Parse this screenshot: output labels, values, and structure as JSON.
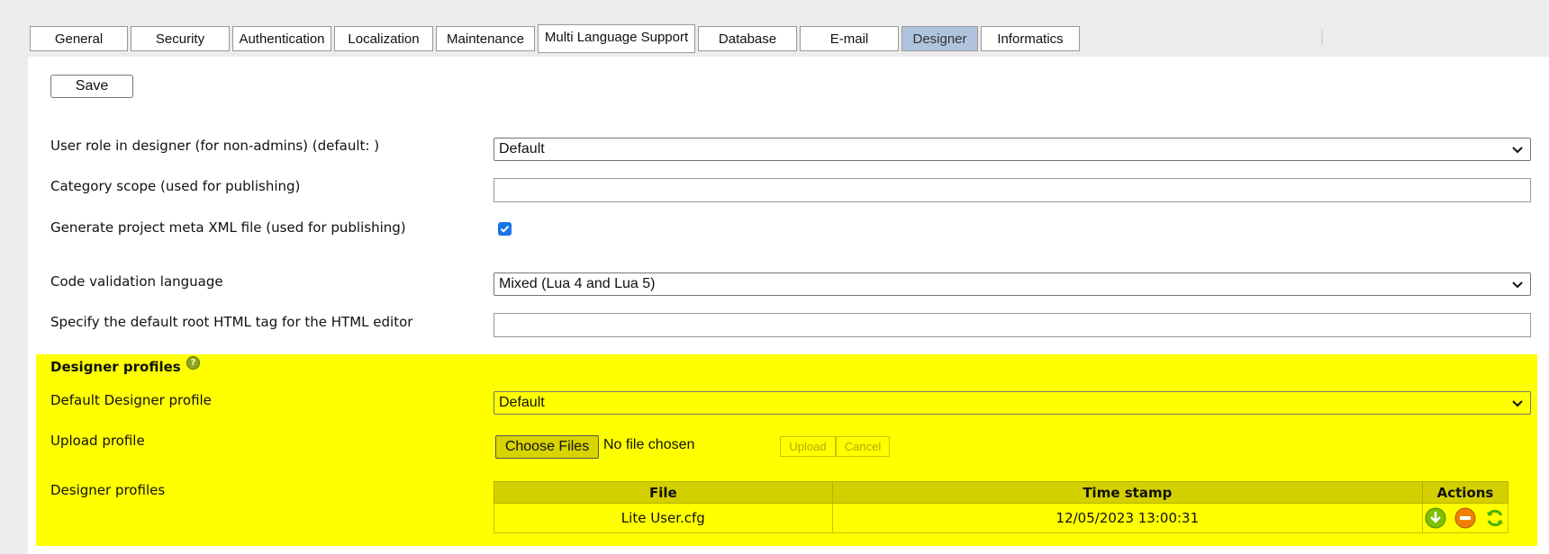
{
  "tabs": [
    {
      "label": "General"
    },
    {
      "label": "Security"
    },
    {
      "label": "Authentication"
    },
    {
      "label": "Localization"
    },
    {
      "label": "Maintenance"
    },
    {
      "label": "Multi Language Support"
    },
    {
      "label": "Database"
    },
    {
      "label": "E-mail"
    },
    {
      "label": "Designer",
      "active": true
    },
    {
      "label": "Informatics"
    }
  ],
  "toolbar": {
    "save_label": "Save"
  },
  "settings": {
    "user_role_label": "User role in designer (for non-admins) (default: )",
    "user_role_value": "Default",
    "category_scope_label": "Category scope (used for publishing)",
    "category_scope_value": "",
    "meta_xml_label": "Generate project meta XML file (used for publishing)",
    "meta_xml_checked": true,
    "code_validation_label": "Code validation language",
    "code_validation_value": "Mixed (Lua 4 and Lua 5)",
    "root_html_label": "Specify the default root HTML tag for the HTML editor",
    "root_html_value": ""
  },
  "profiles": {
    "section_title": "Designer profiles",
    "help_icon": "?",
    "default_label": "Default Designer profile",
    "default_value": "Default",
    "upload_label": "Upload profile",
    "choose_files_label": "Choose Files",
    "no_file_text": "No file chosen",
    "upload_button": "Upload",
    "cancel_button": "Cancel",
    "list_label": "Designer profiles",
    "columns": [
      "File",
      "Time stamp",
      "Actions"
    ],
    "rows": [
      {
        "file": "Lite User.cfg",
        "timestamp": "12/05/2023 13:00:31"
      }
    ]
  },
  "colors": {
    "active_tab": "#b0c4de",
    "section_bg": "#ffff00",
    "header_bg": "#d4d000",
    "checkbox": "#1a73e8",
    "action_green": "#7fbf00",
    "action_orange": "#f08000"
  },
  "icons": {
    "download": "download-icon",
    "delete": "delete-icon",
    "refresh": "refresh-icon",
    "chevron": "chevron-down-icon"
  }
}
